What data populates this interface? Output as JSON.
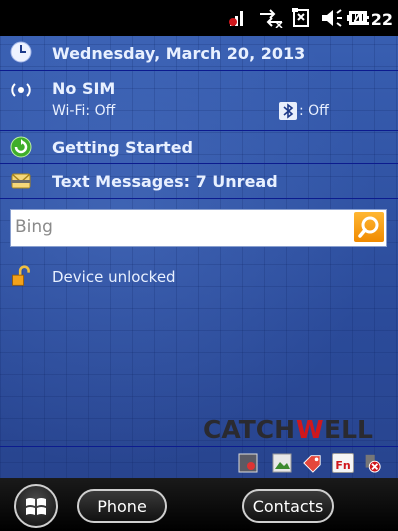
{
  "status_bar": {
    "time": "4:22",
    "icons": [
      "signal-off-icon",
      "data-connection-icon",
      "call-forward-icon",
      "volume-icon",
      "battery-icon"
    ]
  },
  "today": {
    "date": "Wednesday, March 20, 2013",
    "network": {
      "title": "No SIM",
      "wifi": "Wi-Fi: Off",
      "bluetooth": ": Off"
    },
    "getting_started": "Getting Started",
    "messages": "Text Messages: 7 Unread",
    "search": {
      "value": "Bing"
    },
    "lock": "Device unlocked",
    "brand": "CATCHWELL",
    "fn_label": "Fn"
  },
  "softkeys": {
    "left": "Phone",
    "right": "Contacts"
  },
  "colors": {
    "background": "#2d4f9c",
    "divider": "#0c1b8e",
    "brand_red": "#d0171c",
    "bing_orange": "#f59a00"
  }
}
